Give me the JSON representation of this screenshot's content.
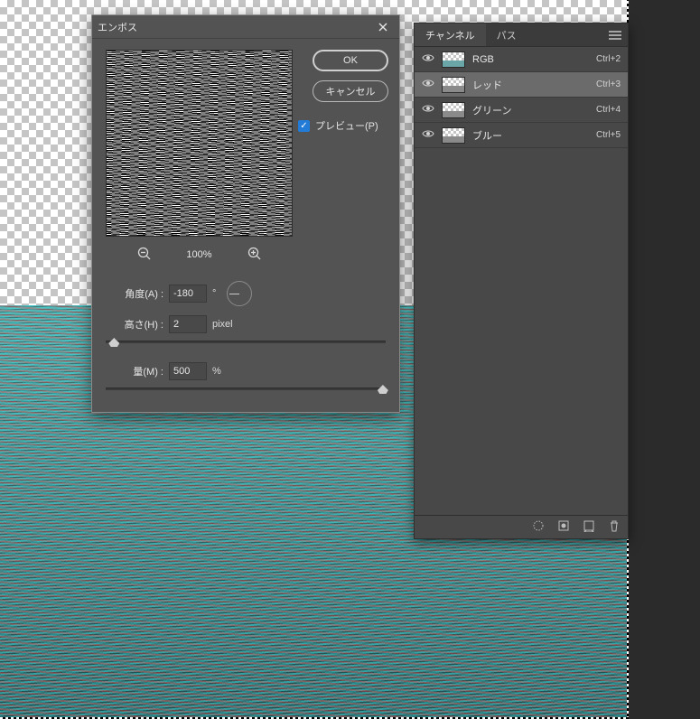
{
  "dialog": {
    "title": "エンボス",
    "ok_label": "OK",
    "cancel_label": "キャンセル",
    "preview_label": "プレビュー(P)",
    "zoom_percent": "100%",
    "angle_label": "角度(A) :",
    "angle_value": "-180",
    "angle_unit": "°",
    "height_label": "高さ(H) :",
    "height_value": "2",
    "height_unit": "pixel",
    "amount_label": "量(M) :",
    "amount_value": "500",
    "amount_unit": "%"
  },
  "panel": {
    "tabs": {
      "channels": "チャンネル",
      "paths": "パス"
    },
    "items": [
      {
        "name": "RGB",
        "shortcut": "Ctrl+2"
      },
      {
        "name": "レッド",
        "shortcut": "Ctrl+3"
      },
      {
        "name": "グリーン",
        "shortcut": "Ctrl+4"
      },
      {
        "name": "ブルー",
        "shortcut": "Ctrl+5"
      }
    ]
  }
}
